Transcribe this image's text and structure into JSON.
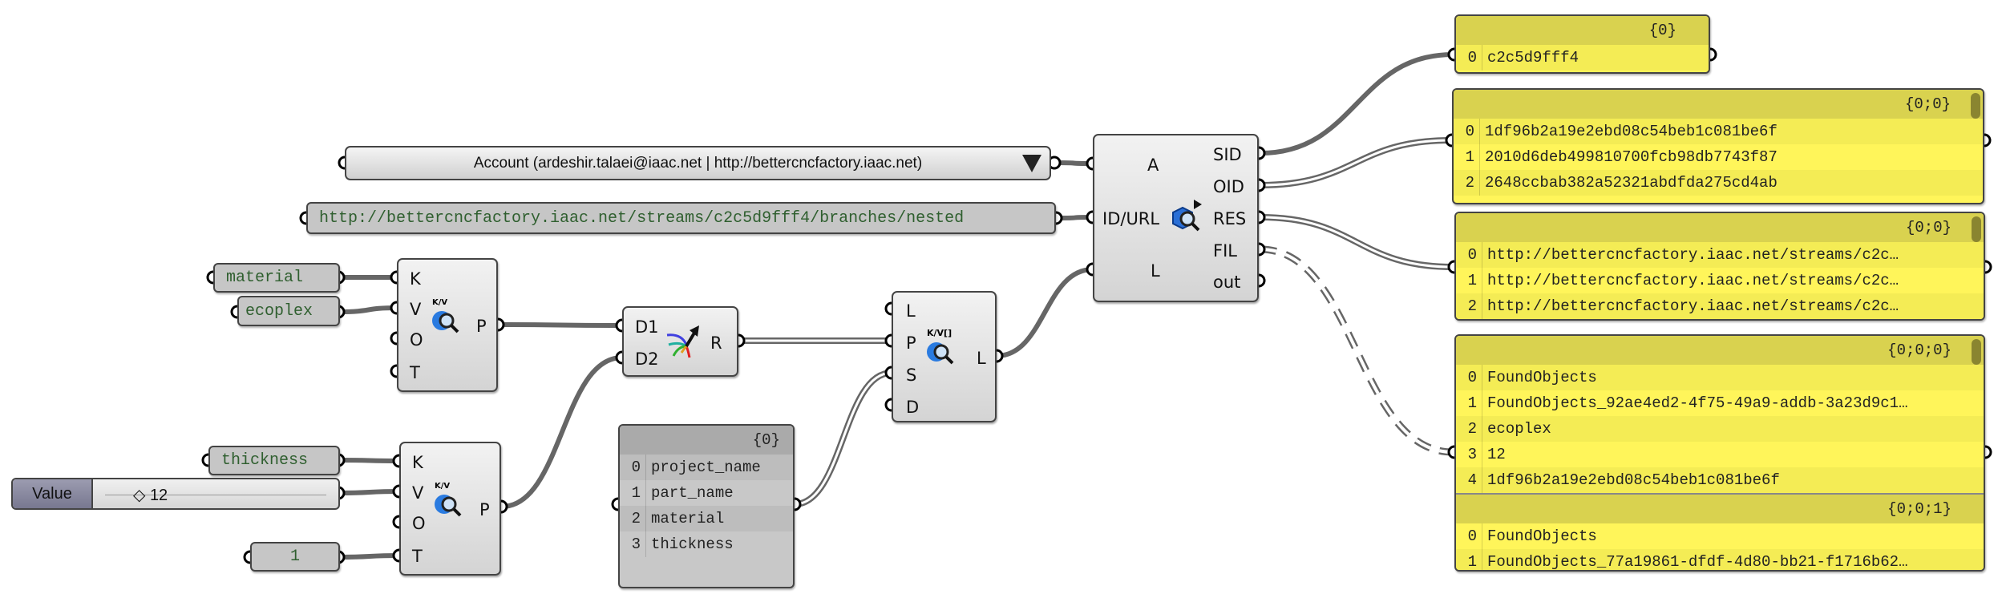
{
  "account_dropdown": {
    "label": "Account (ardeshir.talaei@iaac.net | http://bettercncfactory.iaac.net)"
  },
  "url_panel": {
    "value": "http://bettercncfactory.iaac.net/streams/c2c5d9fff4/branches/nested"
  },
  "receive_component": {
    "inputs": [
      "A",
      "ID/URL",
      "L"
    ],
    "outputs": [
      "SID",
      "OID",
      "RES",
      "FIL",
      "out"
    ],
    "icon": "speckle-receive-icon"
  },
  "kv1": {
    "key_panel": "material",
    "value_panel": "ecoplex",
    "inputs": [
      "K",
      "V",
      "O",
      "T"
    ],
    "output": "P",
    "icon_text": "K/V"
  },
  "kv2": {
    "key_panel": "thickness",
    "slider_name": "Value",
    "slider_value": "12",
    "t_panel": "1",
    "inputs": [
      "K",
      "V",
      "O",
      "T"
    ],
    "output": "P",
    "icon_text": "K/V"
  },
  "merge_component": {
    "inputs": [
      "D1",
      "D2"
    ],
    "output": "R",
    "icon": "merge-icon"
  },
  "keys_list": {
    "header": "{0}",
    "rows": [
      "project_name",
      "part_name",
      "material",
      "thickness"
    ]
  },
  "kv3": {
    "inputs": [
      "L",
      "P",
      "S",
      "D"
    ],
    "output": "L",
    "icon_text": "K/V[]"
  },
  "out_sid": {
    "header": "{0}",
    "rows": [
      "c2c5d9fff4"
    ]
  },
  "out_oid": {
    "header": "{0;0}",
    "rows": [
      "1df96b2a19e2ebd08c54beb1c081be6f",
      "2010d6deb499810700fcb98db7743f87",
      "2648ccbab382a52321abdfda275cd4ab"
    ]
  },
  "out_res": {
    "header": "{0;0}",
    "rows": [
      "http://bettercncfactory.iaac.net/streams/c2c…",
      "http://bettercncfactory.iaac.net/streams/c2c…",
      "http://bettercncfactory.iaac.net/streams/c2c…"
    ]
  },
  "out_fil": {
    "branches": [
      {
        "header": "{0;0;0}",
        "rows": [
          "FoundObjects",
          "FoundObjects_92ae4ed2-4f75-49a9-addb-3a23d9c1…",
          "ecoplex",
          "12",
          "1df96b2a19e2ebd08c54beb1c081be6f"
        ]
      },
      {
        "header": "{0;0;1}",
        "rows": [
          "FoundObjects",
          "FoundObjects_77a19861-dfdf-4d80-bb21-f1716b62…"
        ]
      }
    ]
  },
  "colors": {
    "panel_yellow": "#fff55a",
    "panel_header_yellow": "#d9d24f",
    "wire": "#666666",
    "panel_gray": "#c6c6c6",
    "panel_text": "#2f5f2f"
  }
}
